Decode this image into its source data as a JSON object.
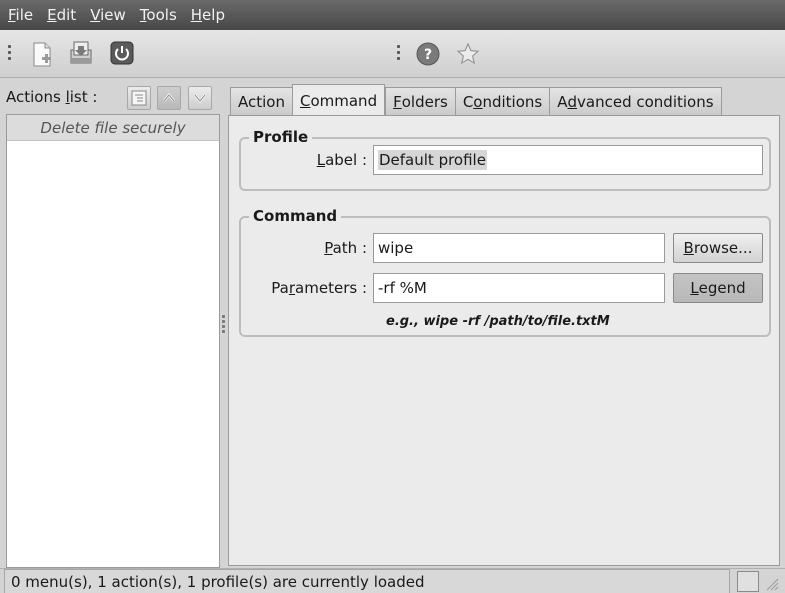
{
  "menubar": {
    "items": [
      {
        "pre": "",
        "u": "F",
        "post": "ile"
      },
      {
        "pre": "",
        "u": "E",
        "post": "dit"
      },
      {
        "pre": "",
        "u": "V",
        "post": "iew"
      },
      {
        "pre": "",
        "u": "T",
        "post": "ools"
      },
      {
        "pre": "",
        "u": "H",
        "post": "elp"
      }
    ]
  },
  "toolbar": {
    "icons": [
      "new-file-icon",
      "save-icon",
      "quit-icon",
      "help-icon",
      "star-icon"
    ]
  },
  "actions_list": {
    "label_pre": "Actions ",
    "label_u": "l",
    "label_post": "ist :",
    "items": [
      "Delete file securely"
    ]
  },
  "tabs": [
    {
      "pre": "Action",
      "u": "",
      "post": ""
    },
    {
      "pre": "",
      "u": "C",
      "post": "ommand"
    },
    {
      "pre": "",
      "u": "F",
      "post": "olders"
    },
    {
      "pre": "C",
      "u": "o",
      "post": "nditions"
    },
    {
      "pre": "A",
      "u": "d",
      "post": "vanced conditions"
    }
  ],
  "active_tab": 1,
  "profile": {
    "title": "Profile",
    "label_pre": "",
    "label_u": "L",
    "label_post": "abel :",
    "label_value": "Default profile"
  },
  "command": {
    "title": "Command",
    "path_pre": "",
    "path_u": "P",
    "path_post": "ath :",
    "path_value": "wipe",
    "browse_pre": "",
    "browse_u": "B",
    "browse_post": "rowse...",
    "params_pre": "Pa",
    "params_u": "r",
    "params_post": "ameters :",
    "params_value": "-rf %M",
    "legend_pre": "",
    "legend_u": "L",
    "legend_post": "egend",
    "hint": "e.g., wipe -rf /path/to/file.txtM"
  },
  "status": {
    "text": "0 menu(s), 1 action(s), 1 profile(s) are currently loaded"
  }
}
